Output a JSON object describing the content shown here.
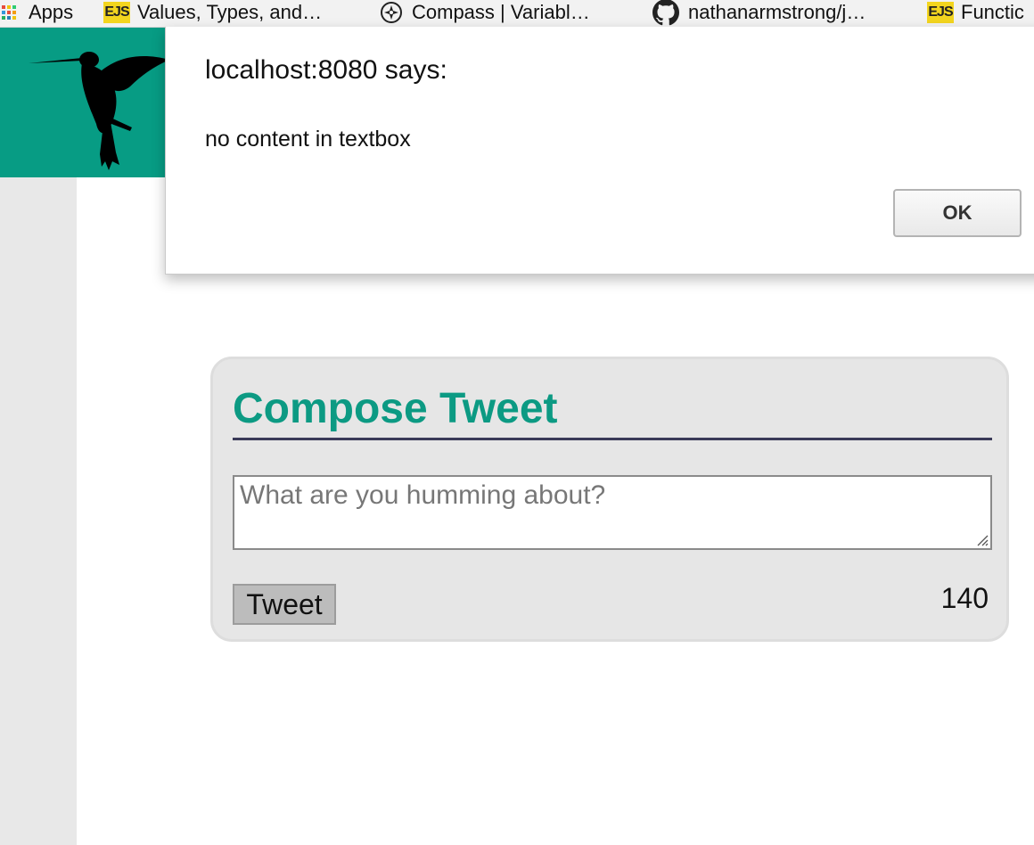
{
  "bookmarks": [
    {
      "label": "Apps",
      "icon": "apps-grid-icon"
    },
    {
      "label": "Values, Types, and…",
      "icon": "ejs-icon"
    },
    {
      "label": "Compass | Variabl…",
      "icon": "compass-icon"
    },
    {
      "label": "nathanarmstrong/j…",
      "icon": "github-icon"
    },
    {
      "label": "Functic",
      "icon": "ejs-icon"
    }
  ],
  "ejs_icon_text": "EJS",
  "header": {
    "logo_icon": "hummingbird-logo-icon",
    "color": "#079c84"
  },
  "dialog": {
    "title": "localhost:8080 says:",
    "message": "no content in textbox",
    "ok_label": "OK"
  },
  "compose": {
    "title": "Compose Tweet",
    "textarea_value": "",
    "textarea_placeholder": "What are you humming about?",
    "tweet_button_label": "Tweet",
    "char_counter": "140",
    "title_color": "#0c9a83",
    "rule_color": "#3a3a58"
  }
}
